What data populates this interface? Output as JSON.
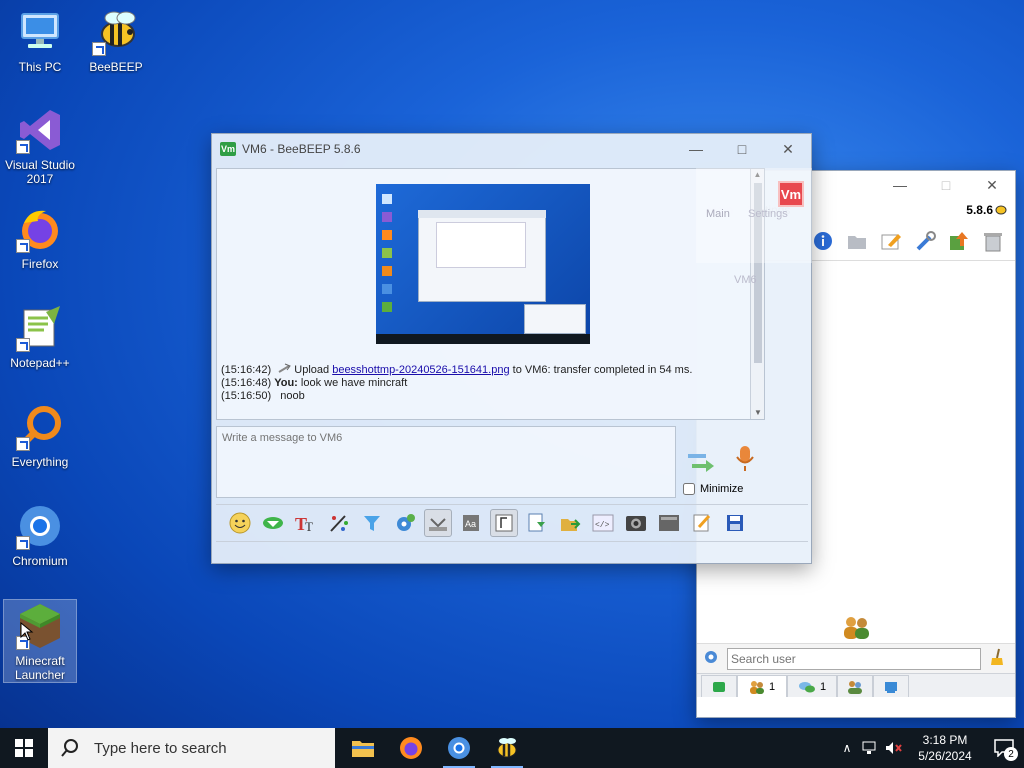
{
  "desktop": {
    "icons": [
      {
        "label": "This PC"
      },
      {
        "label": "BeeBEEP"
      },
      {
        "label": "Visual Studio 2017"
      },
      {
        "label": "Firefox"
      },
      {
        "label": "Notepad++"
      },
      {
        "label": "Everything"
      },
      {
        "label": "Chromium"
      },
      {
        "label": "Minecraft Launcher"
      }
    ]
  },
  "chat_window": {
    "title": "VM6 - BeeBEEP 5.8.6",
    "badge": "Vm",
    "messages": [
      {
        "time": "(15:16:42)",
        "prefix": "Upload",
        "link": "beesshottmp-20240526-151641.png",
        "suffix": "to VM6: transfer completed in 54 ms."
      },
      {
        "time": "(15:16:48)",
        "author": "You:",
        "text": "look we have mincraft"
      },
      {
        "time": "(15:16:50)",
        "text": "noob"
      }
    ],
    "input_placeholder": "Write a message to VM6",
    "minimize_label": "Minimize",
    "minimize_checked": false
  },
  "main_window": {
    "version": "5.8.6",
    "badge": "Vm",
    "menu": [
      "Main",
      "Settings"
    ],
    "user_label": "VM6",
    "search_placeholder": "Search user",
    "tabs": [
      {
        "count": "1"
      },
      {
        "count": "1"
      }
    ]
  },
  "taskbar": {
    "search_placeholder": "Type here to search",
    "time": "3:18 PM",
    "date": "5/26/2024",
    "notification_count": "2"
  },
  "colors": {
    "accent": "#0078d7",
    "badge_red": "#e8484f",
    "link": "#1a0dab"
  }
}
